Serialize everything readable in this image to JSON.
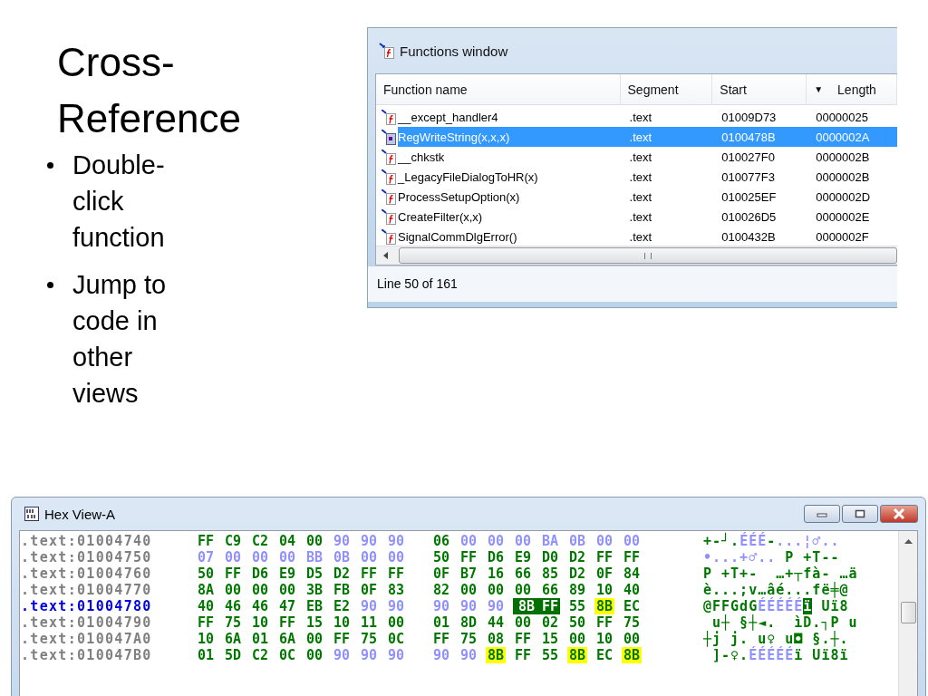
{
  "slide": {
    "title": "Cross-Reference",
    "bullets": [
      "Double-click function",
      "Jump to code in other views"
    ]
  },
  "functions_window": {
    "title": "Functions window",
    "columns": [
      {
        "label": "Function name"
      },
      {
        "label": "Segment"
      },
      {
        "label": "Start"
      },
      {
        "label": "Length",
        "sort_indicator": "▼"
      }
    ],
    "rows": [
      {
        "name": "__except_handler4",
        "segment": ".text",
        "start": "01009D73",
        "length": "00000025",
        "selected": false
      },
      {
        "name": "RegWriteString(x,x,x)",
        "segment": ".text",
        "start": "0100478B",
        "length": "0000002A",
        "selected": true
      },
      {
        "name": "__chkstk",
        "segment": ".text",
        "start": "010027F0",
        "length": "0000002B",
        "selected": false
      },
      {
        "name": "_LegacyFileDialogToHR(x)",
        "segment": ".text",
        "start": "010077F3",
        "length": "0000002B",
        "selected": false
      },
      {
        "name": "ProcessSetupOption(x)",
        "segment": ".text",
        "start": "010025EF",
        "length": "0000002D",
        "selected": false
      },
      {
        "name": "CreateFilter(x,x)",
        "segment": ".text",
        "start": "010026D5",
        "length": "0000002E",
        "selected": false
      },
      {
        "name": "SignalCommDlgError()",
        "segment": ".text",
        "start": "0100432B",
        "length": "0000002F",
        "selected": false
      }
    ],
    "status": "Line 50 of 161"
  },
  "hex_view": {
    "title": "Hex View-A",
    "rows": [
      {
        "address": ".text:01004740",
        "current": false,
        "bytes": [
          {
            "v": "FF",
            "kind": "code"
          },
          {
            "v": "C9",
            "kind": "code"
          },
          {
            "v": "C2",
            "kind": "code"
          },
          {
            "v": "04",
            "kind": "code"
          },
          {
            "v": "00",
            "kind": "code"
          },
          {
            "v": "90",
            "kind": "data"
          },
          {
            "v": "90",
            "kind": "data"
          },
          {
            "v": "90",
            "kind": "data"
          },
          {
            "v": "06",
            "kind": "code"
          },
          {
            "v": "00",
            "kind": "data"
          },
          {
            "v": "00",
            "kind": "data"
          },
          {
            "v": "00",
            "kind": "data"
          },
          {
            "v": "BA",
            "kind": "data"
          },
          {
            "v": "0B",
            "kind": "data"
          },
          {
            "v": "00",
            "kind": "data"
          },
          {
            "v": "00",
            "kind": "data"
          }
        ],
        "ascii": [
          {
            "text": "+-┘.",
            "kind": "code"
          },
          {
            "text": "ÉÉÉ",
            "kind": "data"
          },
          {
            "text": "-",
            "kind": "code"
          },
          {
            "text": "...¦♂..",
            "kind": "data"
          }
        ]
      },
      {
        "address": ".text:01004750",
        "current": false,
        "bytes": [
          {
            "v": "07",
            "kind": "data"
          },
          {
            "v": "00",
            "kind": "data"
          },
          {
            "v": "00",
            "kind": "data"
          },
          {
            "v": "00",
            "kind": "data"
          },
          {
            "v": "BB",
            "kind": "data"
          },
          {
            "v": "0B",
            "kind": "data"
          },
          {
            "v": "00",
            "kind": "data"
          },
          {
            "v": "00",
            "kind": "data"
          },
          {
            "v": "50",
            "kind": "code"
          },
          {
            "v": "FF",
            "kind": "code"
          },
          {
            "v": "D6",
            "kind": "code"
          },
          {
            "v": "E9",
            "kind": "code"
          },
          {
            "v": "D0",
            "kind": "code"
          },
          {
            "v": "D2",
            "kind": "code"
          },
          {
            "v": "FF",
            "kind": "code"
          },
          {
            "v": "FF",
            "kind": "code"
          }
        ],
        "ascii": [
          {
            "text": "•...+♂..",
            "kind": "data"
          },
          {
            "text": " P +T--",
            "kind": "code"
          }
        ]
      },
      {
        "address": ".text:01004760",
        "current": false,
        "bytes": [
          {
            "v": "50",
            "kind": "code"
          },
          {
            "v": "FF",
            "kind": "code"
          },
          {
            "v": "D6",
            "kind": "code"
          },
          {
            "v": "E9",
            "kind": "code"
          },
          {
            "v": "D5",
            "kind": "code"
          },
          {
            "v": "D2",
            "kind": "code"
          },
          {
            "v": "FF",
            "kind": "code"
          },
          {
            "v": "FF",
            "kind": "code"
          },
          {
            "v": "0F",
            "kind": "code"
          },
          {
            "v": "B7",
            "kind": "code"
          },
          {
            "v": "16",
            "kind": "code"
          },
          {
            "v": "66",
            "kind": "code"
          },
          {
            "v": "85",
            "kind": "code"
          },
          {
            "v": "D2",
            "kind": "code"
          },
          {
            "v": "0F",
            "kind": "code"
          },
          {
            "v": "84",
            "kind": "code"
          }
        ],
        "ascii": [
          {
            "text": "P +T+-  …+┬fà- …ä",
            "kind": "code"
          }
        ]
      },
      {
        "address": ".text:01004770",
        "current": false,
        "bytes": [
          {
            "v": "8A",
            "kind": "code"
          },
          {
            "v": "00",
            "kind": "code"
          },
          {
            "v": "00",
            "kind": "code"
          },
          {
            "v": "00",
            "kind": "code"
          },
          {
            "v": "3B",
            "kind": "code"
          },
          {
            "v": "FB",
            "kind": "code"
          },
          {
            "v": "0F",
            "kind": "code"
          },
          {
            "v": "83",
            "kind": "code"
          },
          {
            "v": "82",
            "kind": "code"
          },
          {
            "v": "00",
            "kind": "code"
          },
          {
            "v": "00",
            "kind": "code"
          },
          {
            "v": "00",
            "kind": "code"
          },
          {
            "v": "66",
            "kind": "code"
          },
          {
            "v": "89",
            "kind": "code"
          },
          {
            "v": "10",
            "kind": "code"
          },
          {
            "v": "40",
            "kind": "code"
          }
        ],
        "ascii": [
          {
            "text": "è...;v…âé...fë╪@",
            "kind": "code"
          }
        ]
      },
      {
        "address": ".text:01004780",
        "current": true,
        "bytes": [
          {
            "v": "40",
            "kind": "code"
          },
          {
            "v": "46",
            "kind": "code"
          },
          {
            "v": "46",
            "kind": "code"
          },
          {
            "v": "47",
            "kind": "code"
          },
          {
            "v": "EB",
            "kind": "code"
          },
          {
            "v": "E2",
            "kind": "code"
          },
          {
            "v": "90",
            "kind": "data"
          },
          {
            "v": "90",
            "kind": "data"
          },
          {
            "v": "90",
            "kind": "data"
          },
          {
            "v": "90",
            "kind": "data"
          },
          {
            "v": "90",
            "kind": "data"
          },
          {
            "v": "8B",
            "kind": "sel"
          },
          {
            "v": "FF",
            "kind": "sel"
          },
          {
            "v": "55",
            "kind": "code"
          },
          {
            "v": "8B",
            "kind": "hl"
          },
          {
            "v": "EC",
            "kind": "code"
          }
        ],
        "ascii": [
          {
            "text": "@FFGdG",
            "kind": "code"
          },
          {
            "text": "ÉÉÉÉÉ",
            "kind": "data"
          },
          {
            "text": "ï",
            "kind": "sel"
          },
          {
            "text": " Uï8",
            "kind": "code"
          }
        ]
      },
      {
        "address": ".text:01004790",
        "current": false,
        "bytes": [
          {
            "v": "FF",
            "kind": "code"
          },
          {
            "v": "75",
            "kind": "code"
          },
          {
            "v": "10",
            "kind": "code"
          },
          {
            "v": "FF",
            "kind": "code"
          },
          {
            "v": "15",
            "kind": "code"
          },
          {
            "v": "10",
            "kind": "code"
          },
          {
            "v": "11",
            "kind": "code"
          },
          {
            "v": "00",
            "kind": "code"
          },
          {
            "v": "01",
            "kind": "code"
          },
          {
            "v": "8D",
            "kind": "code"
          },
          {
            "v": "44",
            "kind": "code"
          },
          {
            "v": "00",
            "kind": "code"
          },
          {
            "v": "02",
            "kind": "code"
          },
          {
            "v": "50",
            "kind": "code"
          },
          {
            "v": "FF",
            "kind": "code"
          },
          {
            "v": "75",
            "kind": "code"
          }
        ],
        "ascii": [
          {
            "text": " u┼ §┼◄.  ìD.┐P u",
            "kind": "code"
          }
        ]
      },
      {
        "address": ".text:010047A0",
        "current": false,
        "bytes": [
          {
            "v": "10",
            "kind": "code"
          },
          {
            "v": "6A",
            "kind": "code"
          },
          {
            "v": "01",
            "kind": "code"
          },
          {
            "v": "6A",
            "kind": "code"
          },
          {
            "v": "00",
            "kind": "code"
          },
          {
            "v": "FF",
            "kind": "code"
          },
          {
            "v": "75",
            "kind": "code"
          },
          {
            "v": "0C",
            "kind": "code"
          },
          {
            "v": "FF",
            "kind": "code"
          },
          {
            "v": "75",
            "kind": "code"
          },
          {
            "v": "08",
            "kind": "code"
          },
          {
            "v": "FF",
            "kind": "code"
          },
          {
            "v": "15",
            "kind": "code"
          },
          {
            "v": "00",
            "kind": "code"
          },
          {
            "v": "10",
            "kind": "code"
          },
          {
            "v": "00",
            "kind": "code"
          }
        ],
        "ascii": [
          {
            "text": "┼j j. u♀ u◘ §.┼.",
            "kind": "code"
          }
        ]
      },
      {
        "address": ".text:010047B0",
        "current": false,
        "bytes": [
          {
            "v": "01",
            "kind": "code"
          },
          {
            "v": "5D",
            "kind": "code"
          },
          {
            "v": "C2",
            "kind": "code"
          },
          {
            "v": "0C",
            "kind": "code"
          },
          {
            "v": "00",
            "kind": "code"
          },
          {
            "v": "90",
            "kind": "data"
          },
          {
            "v": "90",
            "kind": "data"
          },
          {
            "v": "90",
            "kind": "data"
          },
          {
            "v": "90",
            "kind": "data"
          },
          {
            "v": "90",
            "kind": "data"
          },
          {
            "v": "8B",
            "kind": "hl"
          },
          {
            "v": "FF",
            "kind": "code"
          },
          {
            "v": "55",
            "kind": "code"
          },
          {
            "v": "8B",
            "kind": "hl"
          },
          {
            "v": "EC",
            "kind": "code"
          },
          {
            "v": "8B",
            "kind": "hl"
          }
        ],
        "ascii": [
          {
            "text": " ]-♀.",
            "kind": "code"
          },
          {
            "text": "ÉÉÉÉÉ",
            "kind": "data"
          },
          {
            "text": "ï Uï8ï",
            "kind": "code"
          }
        ]
      }
    ]
  }
}
